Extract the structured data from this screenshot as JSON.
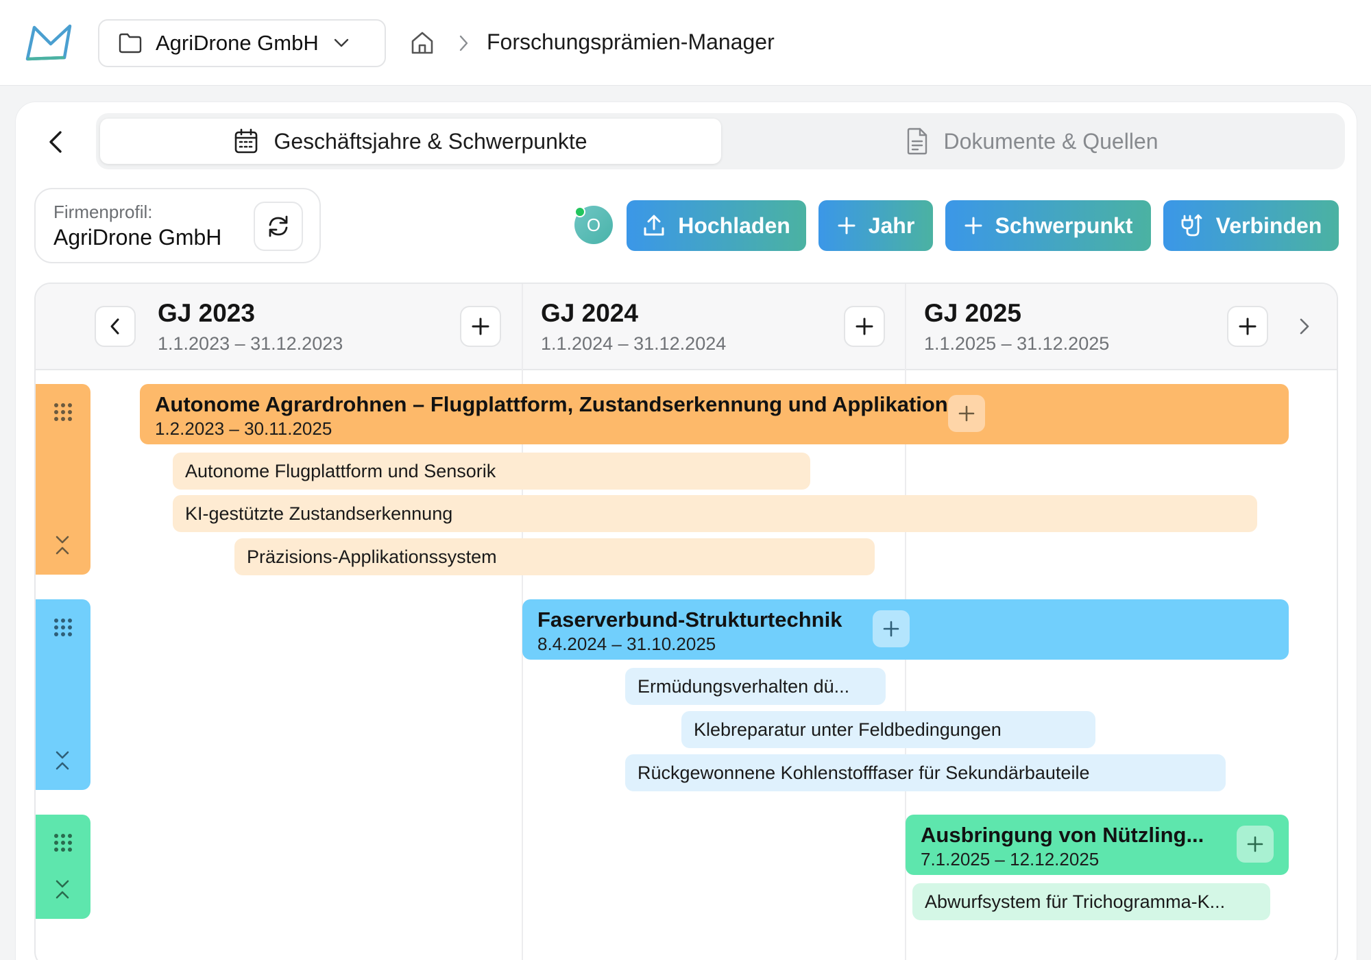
{
  "header": {
    "org_name": "AgriDrone GmbH",
    "page_title": "Forschungsprämien-Manager"
  },
  "tabs": [
    {
      "label": "Geschäftsjahre & Schwerpunkte",
      "active": true
    },
    {
      "label": "Dokumente & Quellen",
      "active": false
    }
  ],
  "profile": {
    "caption": "Firmenprofil:",
    "name": "AgriDrone GmbH"
  },
  "avatar": {
    "initial": "O",
    "status": "online"
  },
  "actions": {
    "upload": "Hochladen",
    "add_year": "Jahr",
    "add_focus": "Schwerpunkt",
    "connect": "Verbinden"
  },
  "years": [
    {
      "title": "GJ 2023",
      "dates": "1.1.2023 – 31.12.2023"
    },
    {
      "title": "GJ 2024",
      "dates": "1.1.2024 – 31.12.2024"
    },
    {
      "title": "GJ 2025",
      "dates": "1.1.2025 – 31.12.2025"
    }
  ],
  "projects": [
    {
      "title": "Autonome Agrardrohnen – Flugplattform, Zustandserkennung und Applikation",
      "dates": "1.2.2023 – 30.11.2025",
      "color": "#fdb96a",
      "sub_color": "#feebd2",
      "subs": [
        "Autonome Flugplattform und Sensorik",
        "KI-gestützte Zustandserkennung",
        "Präzisions-Applikationssystem"
      ]
    },
    {
      "title": "Faserverbund-Strukturtechnik",
      "dates": "8.4.2024 – 31.10.2025",
      "color": "#71cffc",
      "sub_color": "#dff1fd",
      "subs": [
        "Ermüdungsverhalten dü...",
        "Klebreparatur unter Feldbedingungen",
        "Rückgewonnene Kohlenstofffaser für Sekundärbauteile"
      ]
    },
    {
      "title": "Ausbringung von Nützling...",
      "dates": "7.1.2025 – 12.12.2025",
      "color": "#5ee6ad",
      "sub_color": "#d4f7e6",
      "subs": [
        "Abwurfsystem für Trichogramma-K..."
      ]
    }
  ]
}
